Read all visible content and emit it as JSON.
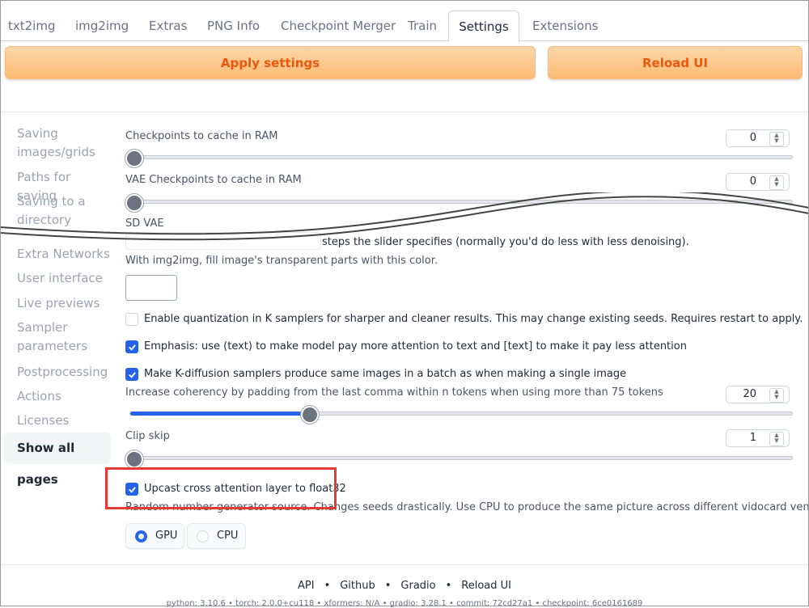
{
  "tabs": [
    "txt2img",
    "img2img",
    "Extras",
    "PNG Info",
    "Checkpoint Merger",
    "Train",
    "Settings",
    "Extensions"
  ],
  "active_tab": "Settings",
  "buttons": {
    "apply": "Apply settings",
    "reload": "Reload UI"
  },
  "sidebar": [
    "Saving images/grids",
    "Paths for saving",
    "Saving to a directory",
    "Extra Networks",
    "User interface",
    "Live previews",
    "Sampler parameters",
    "Postprocessing",
    "Actions",
    "Licenses",
    "Show all pages"
  ],
  "settings": {
    "checkpoints_cache": {
      "label": "Checkpoints to cache in RAM",
      "value": "0"
    },
    "vae_cache": {
      "label": "VAE Checkpoints to cache in RAM",
      "value": "0"
    },
    "sd_vae_label": "SD VAE",
    "img2img_steps_text": "steps the slider specifies (normally you'd do less with less denoising).",
    "img2img_fill_label": "With img2img, fill image's transparent parts with this color.",
    "quantization": {
      "label": "Enable quantization in K samplers for sharper and cleaner results. This may change existing seeds. Requires restart to apply.",
      "checked": false
    },
    "emphasis": {
      "label": "Emphasis: use (text) to make model pay more attention to text and [text] to make it pay less attention",
      "checked": true
    },
    "k_diffusion_batch": {
      "label": "Make K-diffusion samplers produce same images in a batch as when making a single image",
      "checked": true
    },
    "comma_padding": {
      "label": "Increase coherency by padding from the last comma within n tokens when using more than 75 tokens",
      "value": "20",
      "fraction": 0.27
    },
    "clip_skip": {
      "label": "Clip skip",
      "value": "1"
    },
    "upcast_attn": {
      "label": "Upcast cross attention layer to float32",
      "checked": true
    },
    "rng_source": {
      "label": "Random number generator source. Changes seeds drastically. Use CPU to produce the same picture across different vidocard vendors.",
      "options": [
        "GPU",
        "CPU"
      ],
      "selected": "GPU"
    }
  },
  "footer": {
    "links": [
      "API",
      "Github",
      "Gradio",
      "Reload UI"
    ],
    "meta": "python: 3.10.6  •  torch: 2.0.0+cu118  •  xformers: N/A  •  gradio: 3.28.1  •  commit: 72cd27a1  •  checkpoint: 6ce0161689"
  },
  "colors": {
    "accent": "#2563eb",
    "orange_text": "#ea580c",
    "annotation": "#e53935"
  }
}
